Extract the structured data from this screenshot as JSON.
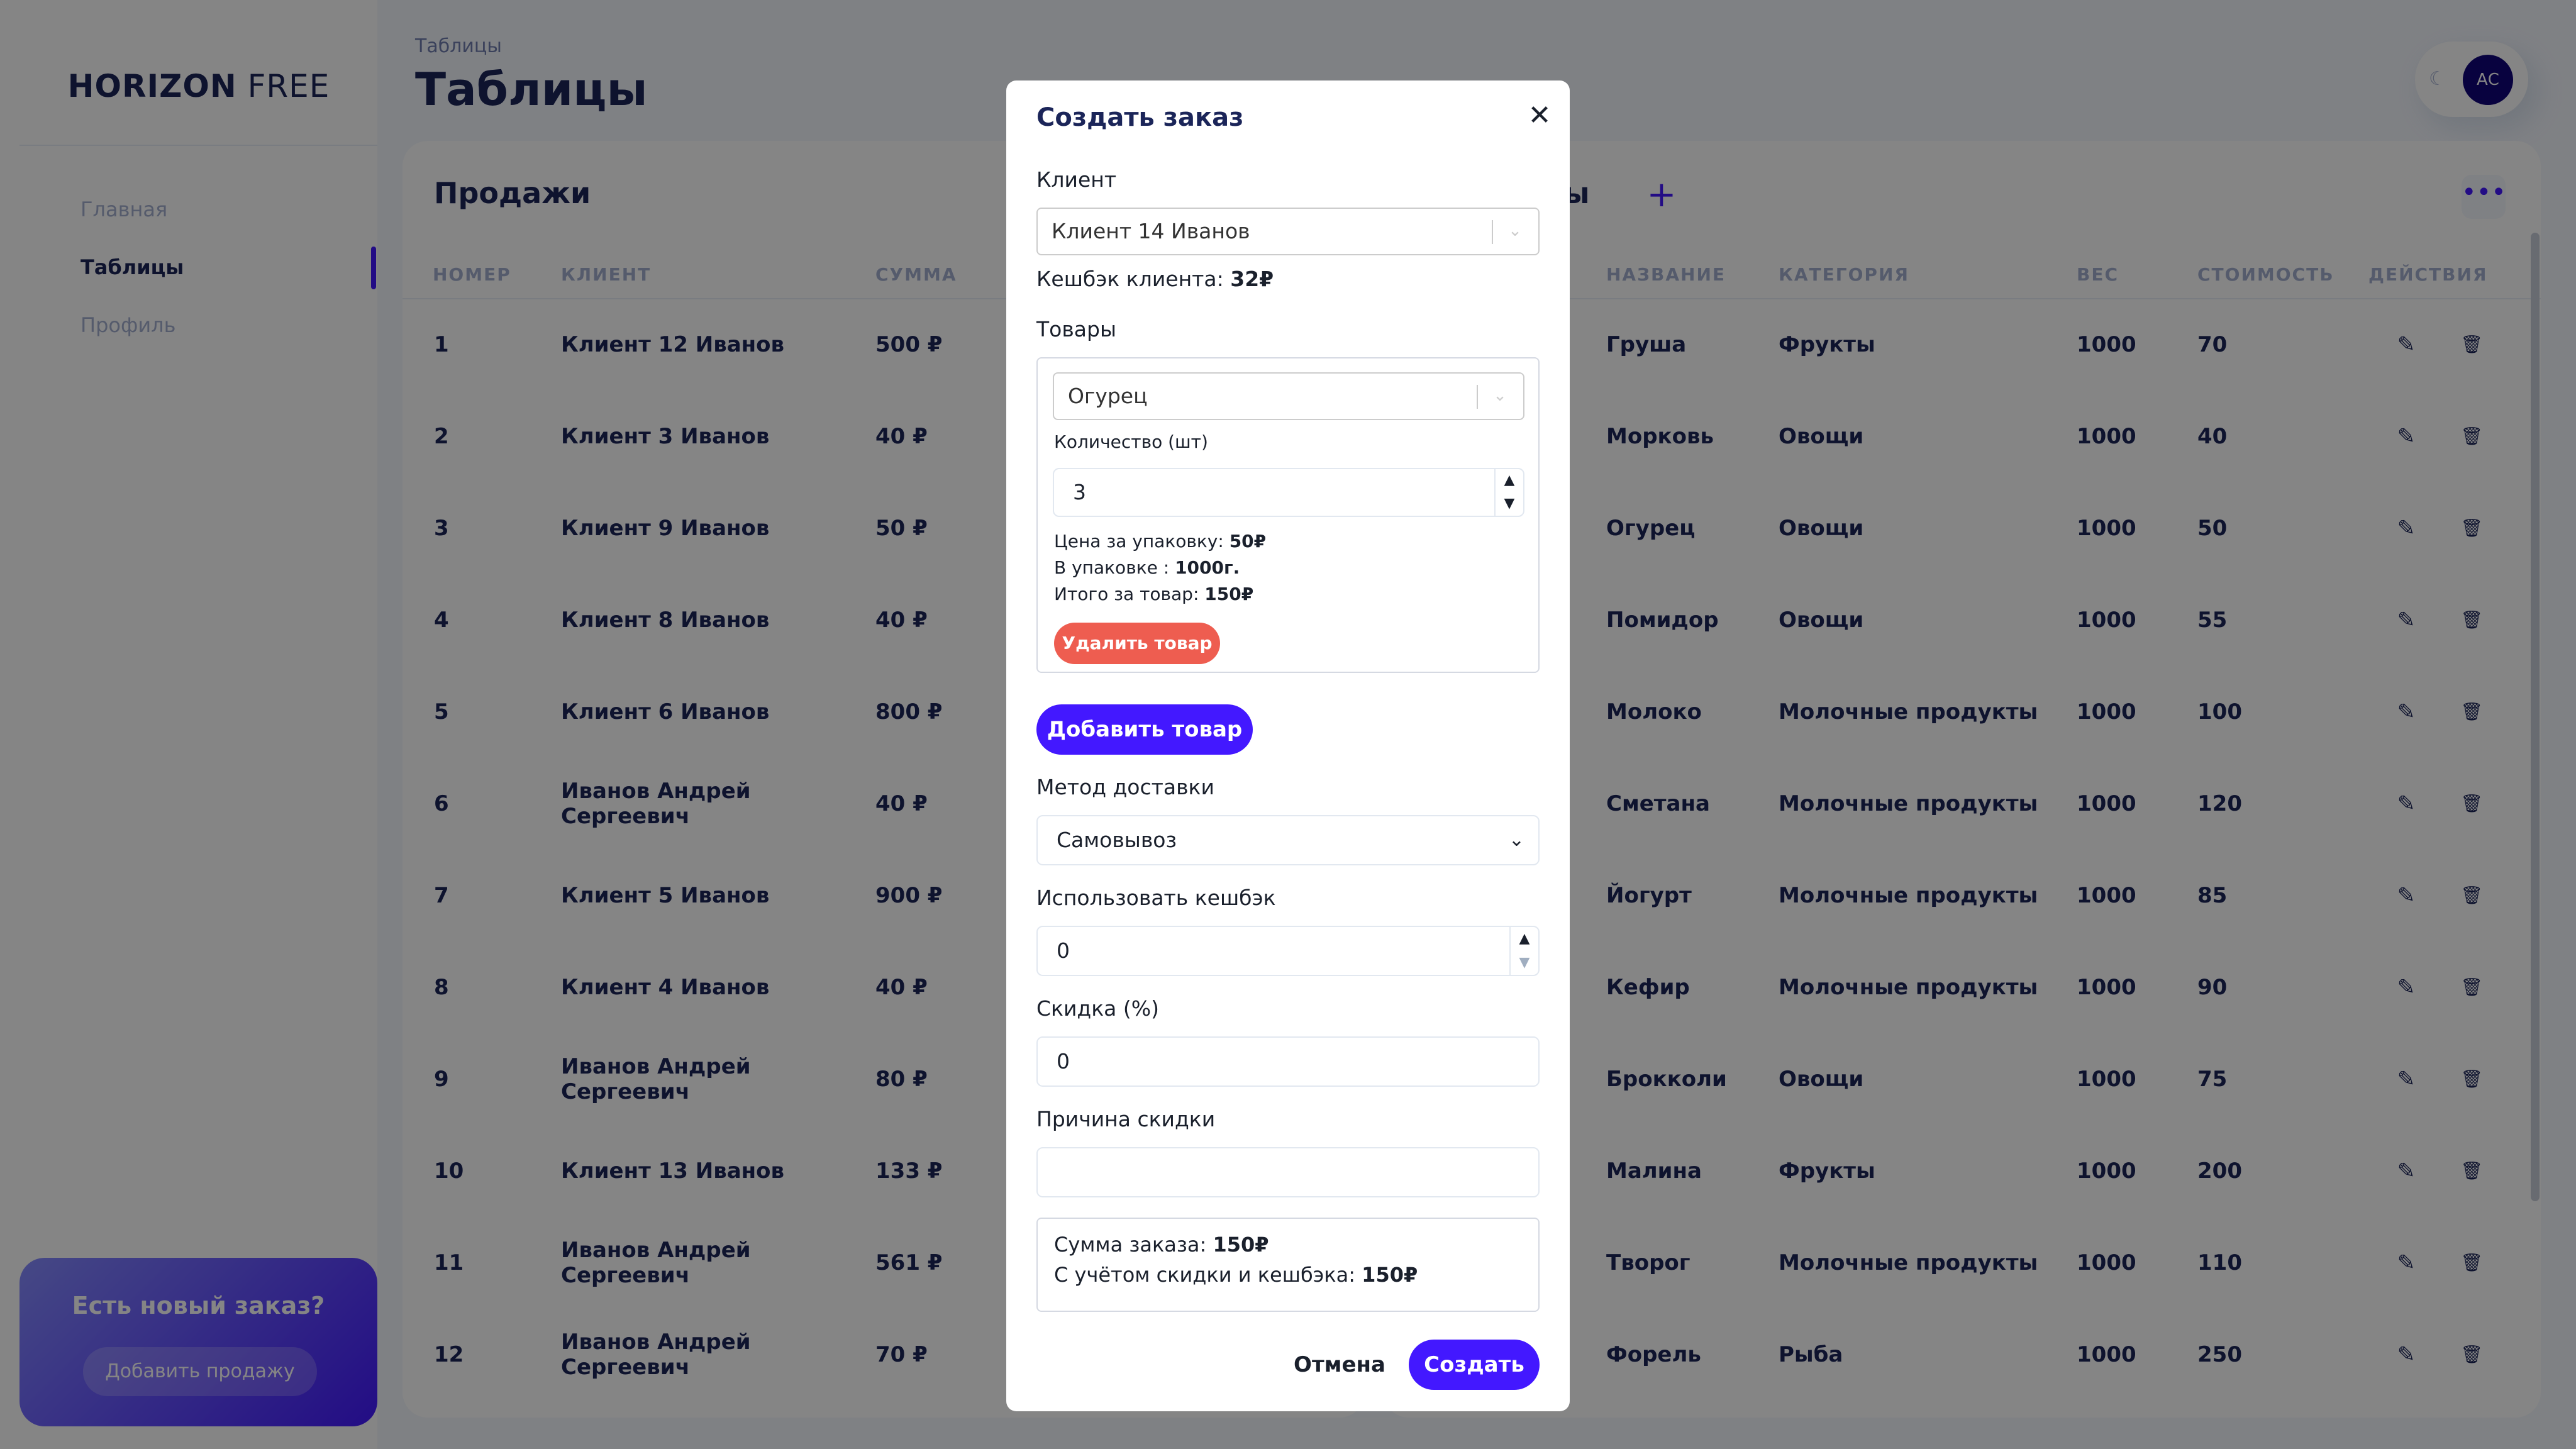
{
  "brand": {
    "bold": "HORIZON",
    "light": "FREE"
  },
  "sidebar": {
    "items": [
      {
        "label": "Главная",
        "active": false
      },
      {
        "label": "Таблицы",
        "active": true
      },
      {
        "label": "Профиль",
        "active": false
      }
    ],
    "promo": {
      "title": "Есть новый заказ?",
      "button": "Добавить продажу"
    }
  },
  "header": {
    "breadcrumb": "Таблицы",
    "title": "Таблицы",
    "avatar_initials": "АС"
  },
  "sales": {
    "title": "Продажи",
    "columns": [
      "НОМЕР",
      "КЛИЕНТ",
      "СУММА"
    ],
    "rows": [
      {
        "num": "1",
        "client": "Клиент 12 Иванов",
        "client2": "",
        "sum": "500 ₽"
      },
      {
        "num": "2",
        "client": "Клиент 3 Иванов",
        "client2": "",
        "sum": "40 ₽"
      },
      {
        "num": "3",
        "client": "Клиент 9 Иванов",
        "client2": "",
        "sum": "50 ₽"
      },
      {
        "num": "4",
        "client": "Клиент 8 Иванов",
        "client2": "",
        "sum": "40 ₽"
      },
      {
        "num": "5",
        "client": "Клиент 6 Иванов",
        "client2": "",
        "sum": "800 ₽"
      },
      {
        "num": "6",
        "client": "Иванов Андрей",
        "client2": "Сергеевич",
        "sum": "40 ₽"
      },
      {
        "num": "7",
        "client": "Клиент 5 Иванов",
        "client2": "",
        "sum": "900 ₽"
      },
      {
        "num": "8",
        "client": "Клиент 4 Иванов",
        "client2": "",
        "sum": "40 ₽"
      },
      {
        "num": "9",
        "client": "Иванов Андрей",
        "client2": "Сергеевич",
        "sum": "80 ₽"
      },
      {
        "num": "10",
        "client": "Клиент 13 Иванов",
        "client2": "",
        "sum": "133 ₽"
      },
      {
        "num": "11",
        "client": "Иванов Андрей",
        "client2": "Сергеевич",
        "sum": "561 ₽"
      },
      {
        "num": "12",
        "client": "Иванов Андрей",
        "client2": "Сергеевич",
        "sum": "70 ₽"
      }
    ]
  },
  "products": {
    "title": "Товары",
    "columns": [
      "НАЗВАНИЕ",
      "КАТЕГОРИЯ",
      "ВЕС",
      "СТОИМОСТЬ",
      "ДЕЙСТВИЯ"
    ],
    "rows": [
      {
        "name": "Груша",
        "category": "Фрукты",
        "weight": "1000",
        "price": "70"
      },
      {
        "name": "Морковь",
        "category": "Овощи",
        "weight": "1000",
        "price": "40"
      },
      {
        "name": "Огурец",
        "category": "Овощи",
        "weight": "1000",
        "price": "50"
      },
      {
        "name": "Помидор",
        "category": "Овощи",
        "weight": "1000",
        "price": "55"
      },
      {
        "name": "Молоко",
        "category": "Молочные продукты",
        "weight": "1000",
        "price": "100"
      },
      {
        "name": "Сметана",
        "category": "Молочные продукты",
        "weight": "1000",
        "price": "120"
      },
      {
        "name": "Йогурт",
        "category": "Молочные продукты",
        "weight": "1000",
        "price": "85"
      },
      {
        "name": "Кефир",
        "category": "Молочные продукты",
        "weight": "1000",
        "price": "90"
      },
      {
        "name": "Брокколи",
        "category": "Овощи",
        "weight": "1000",
        "price": "75"
      },
      {
        "name": "Малина",
        "category": "Фрукты",
        "weight": "1000",
        "price": "200"
      },
      {
        "name": "Творог",
        "category": "Молочные продукты",
        "weight": "1000",
        "price": "110"
      },
      {
        "name": "Форель",
        "category": "Рыба",
        "weight": "1000",
        "price": "250"
      }
    ]
  },
  "modal": {
    "title": "Создать заказ",
    "client_label": "Клиент",
    "client_value": "Клиент 14 Иванов",
    "cashback_label": "Кешбэк клиента:",
    "cashback_value": "32₽",
    "goods_label": "Товары",
    "product_value": "Огурец",
    "qty_label": "Количество (шт)",
    "qty_value": "3",
    "price_label": "Цена за упаковку:",
    "price_value": "50₽",
    "pack_label": "В упаковке :",
    "pack_value": "1000г.",
    "item_total_label": "Итого за товар:",
    "item_total_value": "150₽",
    "remove_button": "Удалить товар",
    "add_button": "Добавить товар",
    "delivery_label": "Метод доставки",
    "delivery_value": "Самовывоз",
    "use_cashback_label": "Использовать кешбэк",
    "use_cashback_value": "0",
    "discount_label": "Скидка (%)",
    "discount_value": "0",
    "reason_label": "Причина скидки",
    "reason_value": "",
    "order_sum_label": "Сумма заказа:",
    "order_sum_value": "150₽",
    "order_total_label": "С учётом скидки и кешбэка:",
    "order_total_value": "150₽",
    "cancel_button": "Отмена",
    "create_button": "Создать"
  }
}
